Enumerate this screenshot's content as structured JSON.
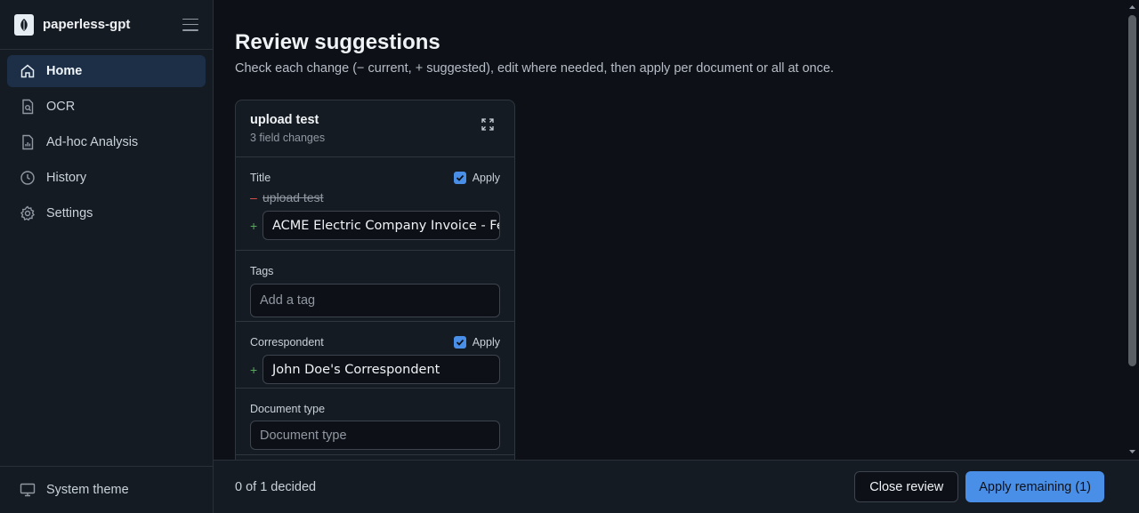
{
  "app": {
    "name": "paperless-gpt"
  },
  "sidebar": {
    "items": [
      {
        "label": "Home",
        "icon": "home-icon",
        "active": true
      },
      {
        "label": "OCR",
        "icon": "file-search-icon",
        "active": false
      },
      {
        "label": "Ad-hoc Analysis",
        "icon": "file-chart-icon",
        "active": false
      },
      {
        "label": "History",
        "icon": "clock-icon",
        "active": false
      },
      {
        "label": "Settings",
        "icon": "gear-icon",
        "active": false
      }
    ],
    "footer": {
      "label": "System theme",
      "icon": "monitor-icon"
    }
  },
  "page": {
    "title": "Review suggestions",
    "description": "Check each change (− current, + suggested), edit where needed, then apply per document or all at once."
  },
  "card": {
    "title": "upload test",
    "subtitle": "3 field changes",
    "fields": {
      "title": {
        "label": "Title",
        "apply_label": "Apply",
        "apply_checked": true,
        "current": "upload test",
        "suggested": "ACME Electric Company Invoice - Feb"
      },
      "tags": {
        "label": "Tags",
        "placeholder": "Add a tag"
      },
      "correspondent": {
        "label": "Correspondent",
        "apply_label": "Apply",
        "apply_checked": true,
        "suggested": "John Doe's Correspondent"
      },
      "document_type": {
        "label": "Document type",
        "placeholder": "Document type"
      }
    }
  },
  "footer_bar": {
    "status": "0 of 1 decided",
    "close_label": "Close review",
    "apply_label": "Apply remaining (1)"
  },
  "colors": {
    "accent": "#4a8fe7",
    "active_nav": "#1c2f47",
    "removed": "#e5534b",
    "added": "#57ab5a"
  }
}
